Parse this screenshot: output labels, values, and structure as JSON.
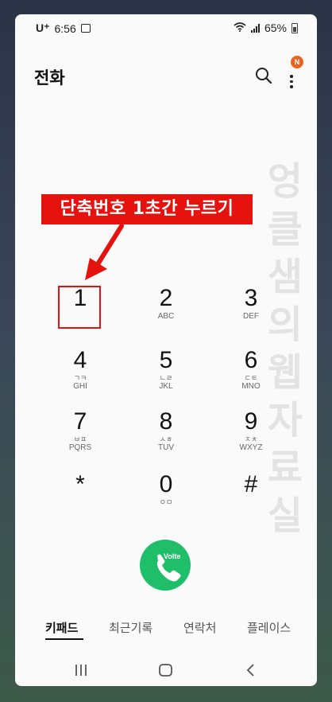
{
  "status": {
    "carrier": "U⁺",
    "time": "6:56",
    "battery": "65%"
  },
  "app": {
    "title": "전화",
    "badge": "N"
  },
  "callout": "단축번호 1초간 누르기",
  "watermark": "엉클샘의웹자료실",
  "keypad": [
    {
      "digit": "1",
      "letters": "",
      "jamo": ""
    },
    {
      "digit": "2",
      "letters": "ABC",
      "jamo": ""
    },
    {
      "digit": "3",
      "letters": "DEF",
      "jamo": ""
    },
    {
      "digit": "4",
      "letters": "GHI",
      "jamo": "ㄱㅋ"
    },
    {
      "digit": "5",
      "letters": "JKL",
      "jamo": "ㄴㄹ"
    },
    {
      "digit": "6",
      "letters": "MNO",
      "jamo": "ㄷㅌ"
    },
    {
      "digit": "7",
      "letters": "PQRS",
      "jamo": "ㅂㅍ"
    },
    {
      "digit": "8",
      "letters": "TUV",
      "jamo": "ㅅㅎ"
    },
    {
      "digit": "9",
      "letters": "WXYZ",
      "jamo": "ㅈㅊ"
    },
    {
      "digit": "*",
      "letters": "",
      "jamo": ""
    },
    {
      "digit": "0",
      "letters": "",
      "jamo": "ㅇㅁ"
    },
    {
      "digit": "#",
      "letters": "",
      "jamo": ""
    }
  ],
  "call": {
    "lte_label": "Volte",
    "color": "#1fbf6a"
  },
  "tabs": [
    "키패드",
    "최근기록",
    "연락처",
    "플레이스"
  ],
  "accent": "#e6120e"
}
